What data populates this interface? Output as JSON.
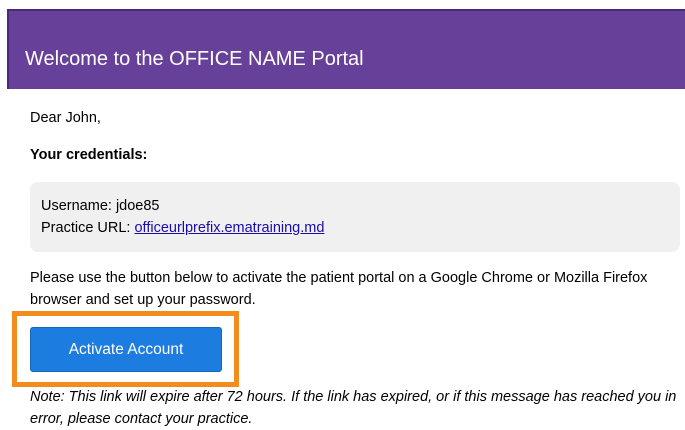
{
  "header": {
    "title": "Welcome to the OFFICE NAME Portal"
  },
  "body": {
    "greeting": "Dear John,",
    "credentials_heading": "Your credentials:",
    "credentials": {
      "username_label": "Username:",
      "username": "jdoe85",
      "practice_url_label": "Practice URL:",
      "practice_url": "officeurlprefix.ematraining.md"
    },
    "instructions": "Please use the button below to activate the patient portal on a Google Chrome or Mozilla Firefox browser and set up your password.",
    "activate_button": "Activate Account",
    "note": "Note: This link will expire after 72 hours. If the link has expired, or if this message has reached you in error, please contact your practice."
  },
  "colors": {
    "header_bg": "#674199",
    "button_bg": "#1d7ce0",
    "highlight_border": "#f28c1c",
    "link": "#1a0dab",
    "credentials_box_bg": "#f0f0f0"
  }
}
